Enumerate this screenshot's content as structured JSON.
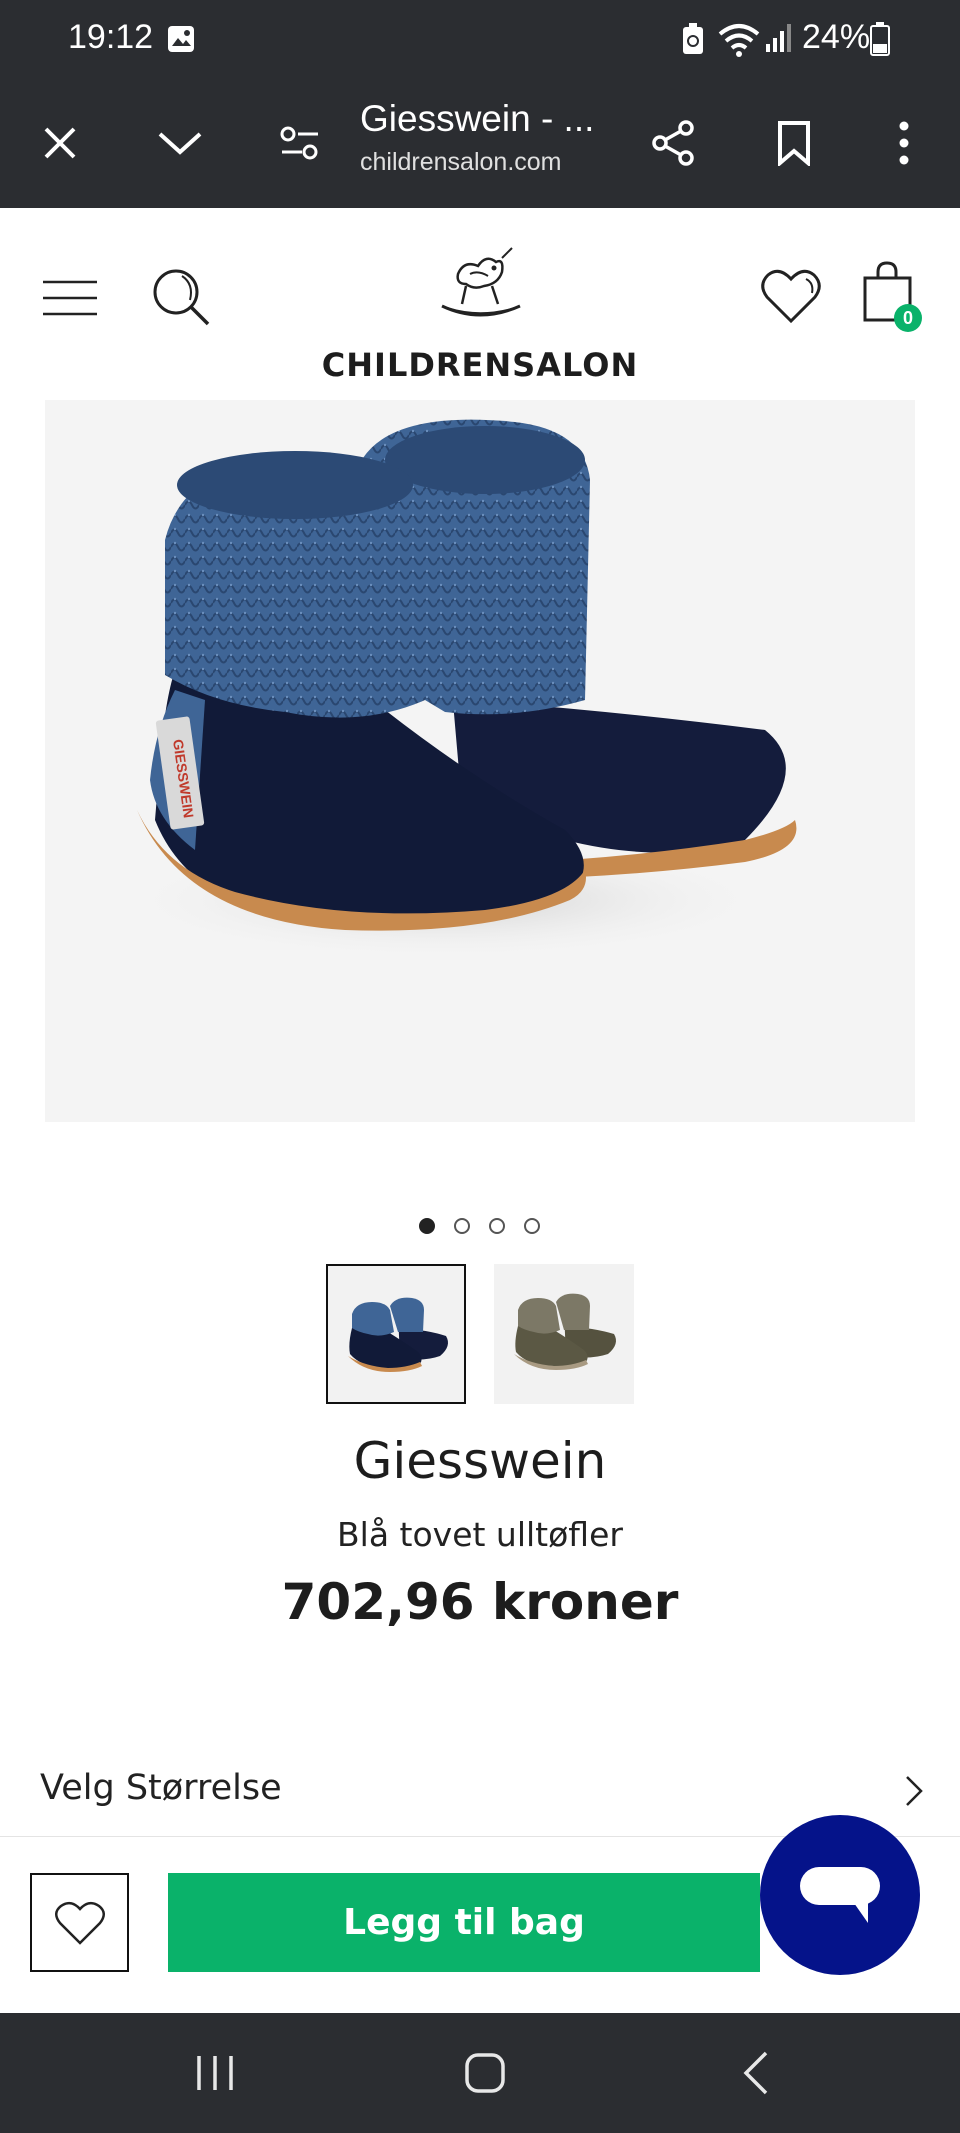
{
  "status_bar": {
    "time": "19:12",
    "battery": "24%"
  },
  "browser": {
    "page_title": "Giesswein - ...",
    "domain": "childrensalon.com"
  },
  "site": {
    "logo_text": "CHILDRENSALON",
    "cart_count": "0"
  },
  "gallery": {
    "dot_count": 4,
    "active_dot": 0
  },
  "product": {
    "brand": "Giesswein",
    "name": "Blå tovet ulltøfler",
    "price": "702,96 kroner"
  },
  "size_selector": {
    "label": "Velg Størrelse"
  },
  "actions": {
    "add_to_bag": "Legg til bag"
  },
  "colors": {
    "accent_green": "#0ab26a",
    "chat_blue": "#05138a",
    "cart_badge": "#0ab26a"
  }
}
